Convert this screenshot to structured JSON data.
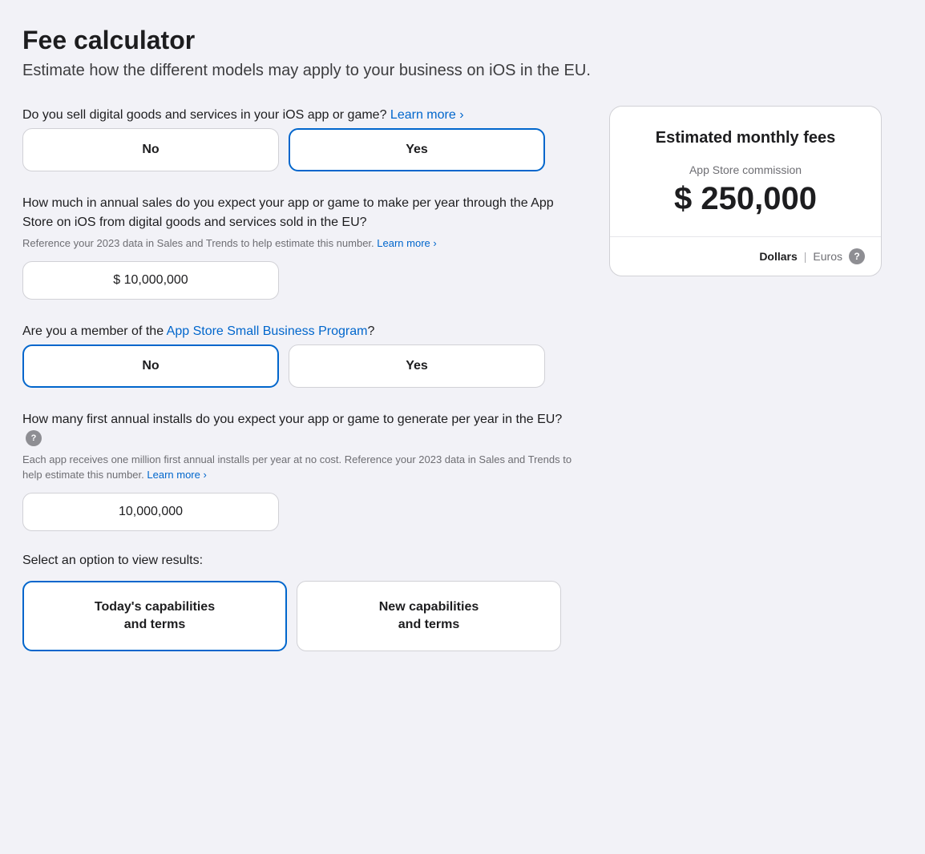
{
  "page": {
    "title": "Fee calculator",
    "subtitle": "Estimate how the different models may apply to your business on iOS in the EU."
  },
  "q1": {
    "text": "Do you sell digital goods and services in your iOS app or game?",
    "link_text": "Learn more ›",
    "options": [
      "No",
      "Yes"
    ],
    "selected": "Yes"
  },
  "q2": {
    "text": "How much in annual sales do you expect your app or game to make per year through the App Store on iOS from digital goods and services sold in the EU?",
    "hint": "Reference your 2023 data in Sales and Trends to help estimate this number.",
    "hint_link": "Learn more ›",
    "value": "$ 10,000,000"
  },
  "q3": {
    "text_before": "Are you a member of the ",
    "link_text": "App Store Small Business Program",
    "text_after": "?",
    "options": [
      "No",
      "Yes"
    ],
    "selected": "No"
  },
  "q4": {
    "text": "How many first annual installs do you expect your app or game to generate per year in the EU?",
    "hint": "Each app receives one million first annual installs per year at no cost. Reference your 2023 data in Sales and Trends to help estimate this number.",
    "hint_link": "Learn more ›",
    "value": "10,000,000"
  },
  "q5": {
    "label": "Select an option to view results:",
    "options": [
      "Today's capabilities\nand terms",
      "New capabilities\nand terms"
    ],
    "selected": "Today's capabilities\nand terms"
  },
  "fees_card": {
    "title": "Estimated monthly fees",
    "commission_label": "App Store commission",
    "amount": "$ 250,000",
    "currency_active": "Dollars",
    "currency_inactive": "Euros",
    "help": "?"
  },
  "icons": {
    "help": "?",
    "chevron_right": "›"
  }
}
